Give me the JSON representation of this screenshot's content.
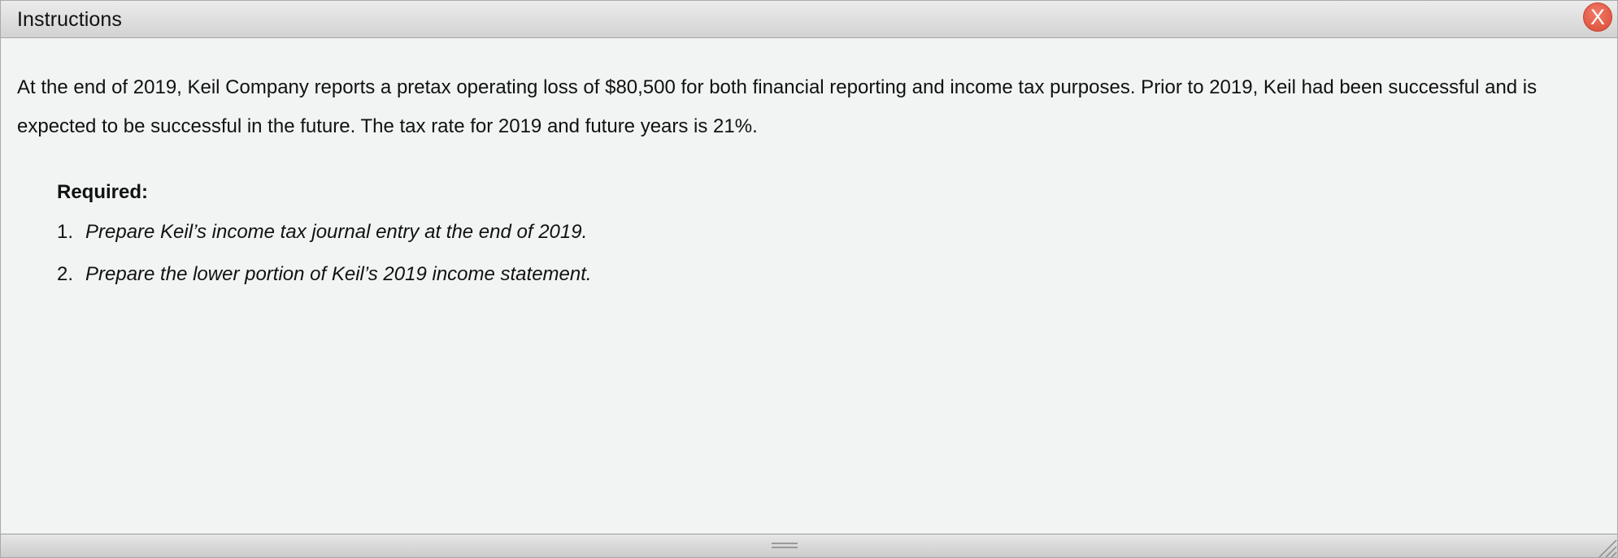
{
  "window": {
    "title": "Instructions",
    "close_label": "X"
  },
  "content": {
    "intro": "At the end of 2019, Keil Company reports a pretax operating loss of $80,500 for both financial reporting and income tax purposes. Prior to 2019, Keil had been successful and is expected to be successful in the future. The tax rate for 2019 and future years is 21%.",
    "required_label": "Required:",
    "requirements": [
      {
        "number": "1.",
        "text": "Prepare Keil’s income tax journal entry at the end of 2019."
      },
      {
        "number": "2.",
        "text": "Prepare the lower portion of Keil’s 2019 income statement."
      }
    ]
  },
  "colors": {
    "content_bg": "#f2f4f3",
    "close_button": "#e4584a",
    "text": "#111111"
  },
  "icons": {
    "close": "close-icon",
    "grip": "drag-grip-icon",
    "resize": "resize-corner-icon"
  }
}
